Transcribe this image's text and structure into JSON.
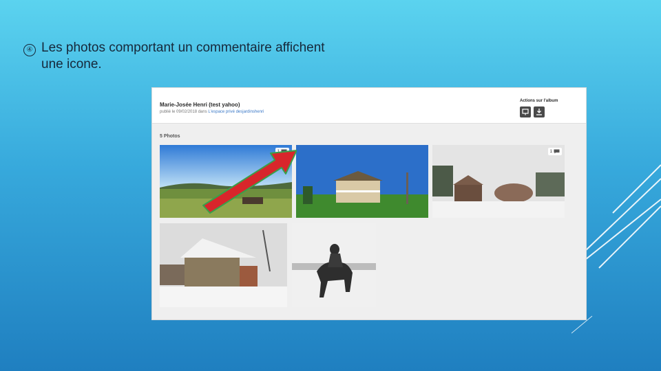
{
  "slide": {
    "bullet_glyph": "④",
    "bullet_text": "Les photos comportant un commentaire affichent une icone."
  },
  "album": {
    "author": "Marie-Josée Henri (test yahoo)",
    "published_prefix": "publié le 09/02/2018 dans",
    "published_link": "L'espace privé desjardinshenri",
    "actions_label": "Actions sur l'album",
    "photos_count": "5 Photos",
    "photos": [
      {
        "name": "field-landscape",
        "comment_count": "1",
        "has_comment": true
      },
      {
        "name": "farmhouse-summer",
        "comment_count": "",
        "has_comment": false
      },
      {
        "name": "barn-winter",
        "comment_count": "1",
        "has_comment": true
      },
      {
        "name": "stone-house-winter",
        "comment_count": "",
        "has_comment": false
      },
      {
        "name": "horse-rider-snow",
        "comment_count": "",
        "has_comment": false
      }
    ]
  },
  "colors": {
    "arrow": "#d8262b",
    "arrow_outline": "#39a04a",
    "link": "#3b79c7"
  },
  "icons": [
    "slideshow-icon",
    "download-icon",
    "comment-icon"
  ]
}
